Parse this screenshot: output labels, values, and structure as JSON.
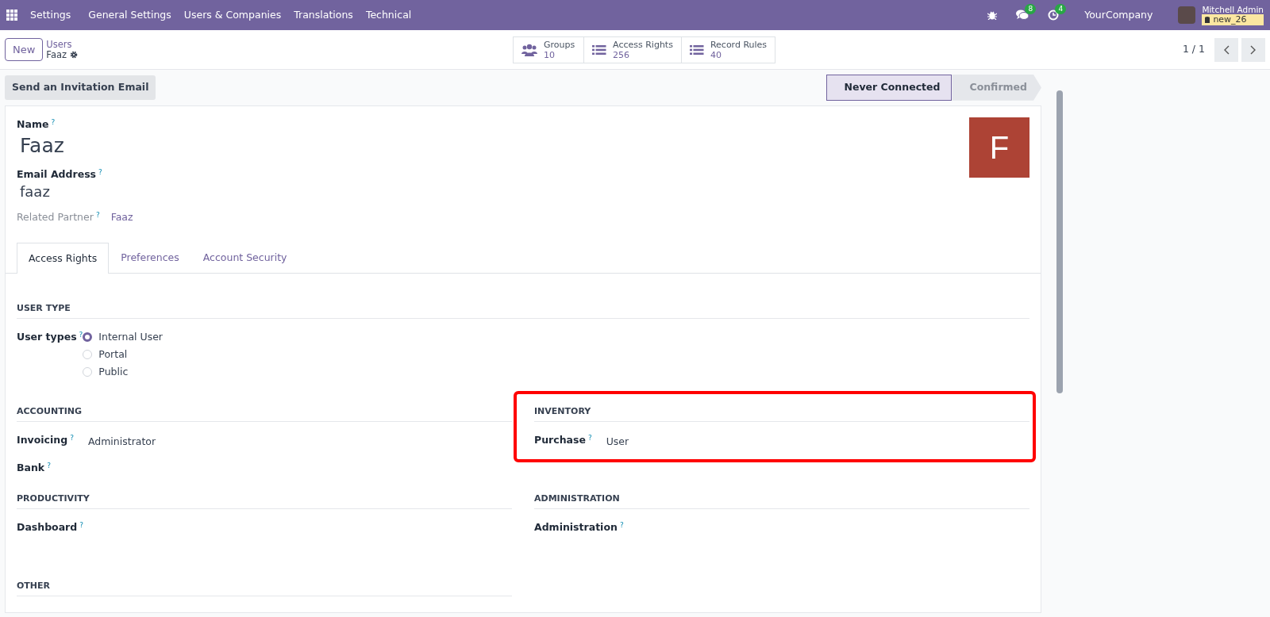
{
  "navbar": {
    "app_name": "Settings",
    "menus": [
      "General Settings",
      "Users & Companies",
      "Translations",
      "Technical"
    ],
    "chat_count": "8",
    "activity_count": "4",
    "company": "YourCompany",
    "user_name": "Mitchell Admin",
    "database": "new_26"
  },
  "control_panel": {
    "new_button": "New",
    "breadcrumb_parent": "Users",
    "breadcrumb_current": "Faaz",
    "smart_buttons": [
      {
        "kind": "groups",
        "label": "Groups",
        "value": "10"
      },
      {
        "kind": "list",
        "label": "Access Rights",
        "value": "256"
      },
      {
        "kind": "list",
        "label": "Record Rules",
        "value": "40"
      }
    ],
    "pager": "1 / 1"
  },
  "action_buttons": [
    "Send an Invitation Email"
  ],
  "statusbar": [
    {
      "label": "Never Connected",
      "selected": true
    },
    {
      "label": "Confirmed",
      "selected": false
    }
  ],
  "form": {
    "avatar_letter": "F",
    "fields": [
      {
        "kind": "title",
        "label": "Name",
        "help": "?",
        "value": "Faaz"
      },
      {
        "kind": "large",
        "label": "Email Address",
        "help": "?",
        "value": "faaz"
      },
      {
        "kind": "inline",
        "label": "Related Partner",
        "help": "?",
        "value": "Faaz"
      }
    ],
    "tabs": [
      {
        "label": "Access Rights",
        "selected": true
      },
      {
        "label": "Preferences",
        "selected": false
      },
      {
        "label": "Account Security",
        "selected": false
      }
    ],
    "sections": [
      {
        "title": "USER TYPE",
        "highlighted": false,
        "fields": [
          {
            "label": "User types",
            "help": "?",
            "options": [
              {
                "label": "Internal User",
                "selected": true
              },
              {
                "label": "Portal",
                "selected": false
              },
              {
                "label": "Public",
                "selected": false
              }
            ]
          }
        ]
      },
      {
        "title": "ACCOUNTING",
        "highlighted": false,
        "fields": [
          {
            "label": "Invoicing",
            "help": "?",
            "value": "Administrator"
          },
          {
            "label": "Bank",
            "help": "?"
          }
        ]
      },
      {
        "title": "INVENTORY",
        "highlighted": true,
        "fields": [
          {
            "label": "Purchase",
            "help": "?",
            "value": "User"
          }
        ]
      },
      {
        "title": "PRODUCTIVITY",
        "highlighted": false,
        "fields": [
          {
            "label": "Dashboard",
            "help": "?"
          }
        ]
      },
      {
        "title": "ADMINISTRATION",
        "highlighted": false,
        "fields": [
          {
            "label": "Administration",
            "help": "?"
          }
        ]
      },
      {
        "title": "OTHER",
        "highlighted": false
      }
    ]
  }
}
